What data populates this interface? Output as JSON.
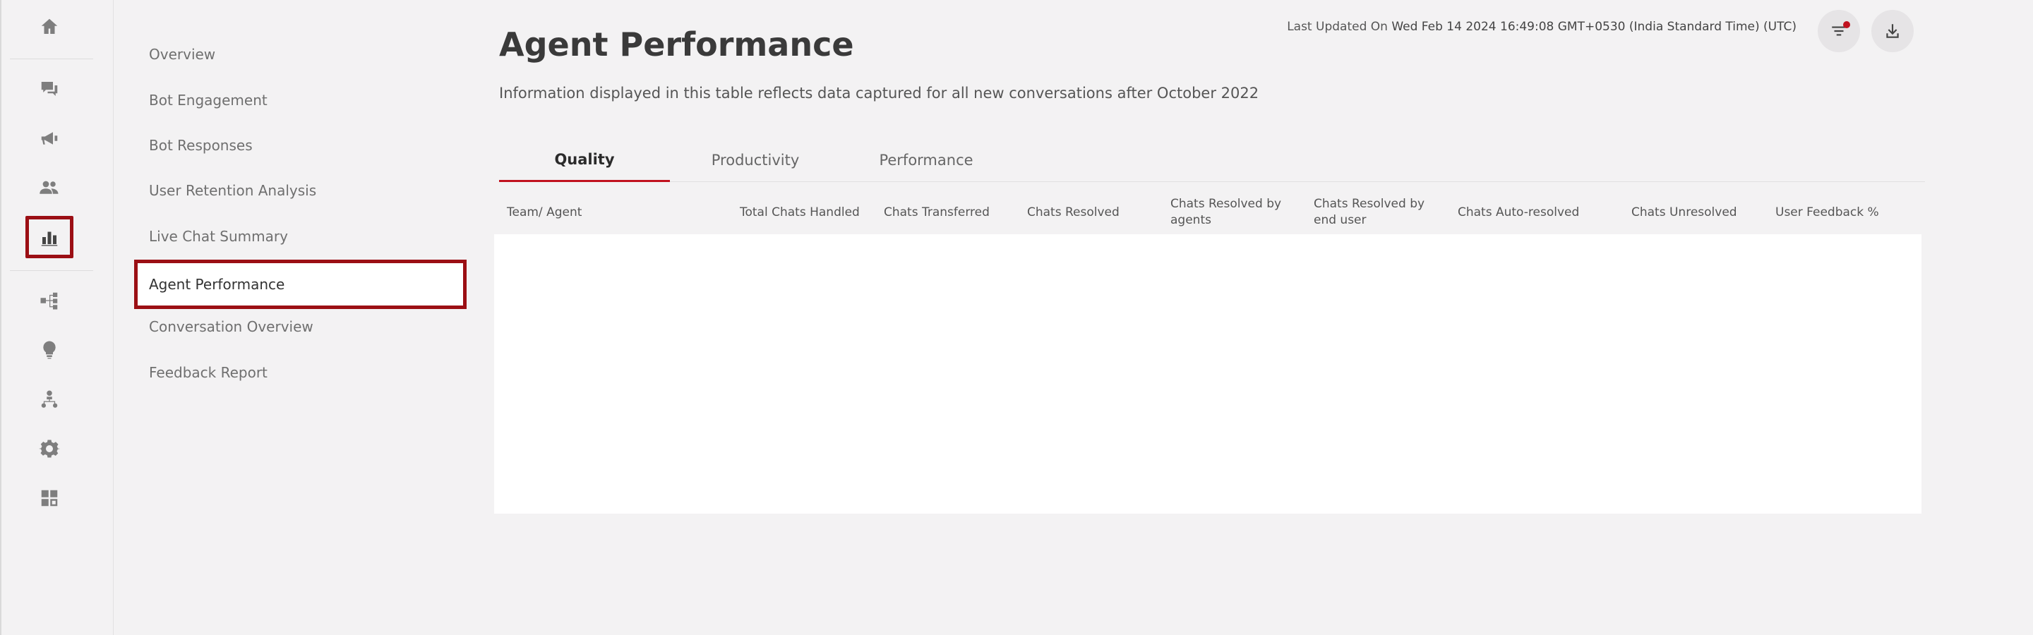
{
  "rail": {
    "icons": [
      "home-icon",
      "chat-icon",
      "megaphone-icon",
      "users-icon",
      "bar-chart-icon",
      "workflow-icon",
      "lightbulb-icon",
      "org-chart-icon",
      "gear-icon",
      "integrations-icon"
    ],
    "active": "bar-chart-icon"
  },
  "subnav": {
    "items": [
      {
        "label": "Overview"
      },
      {
        "label": "Bot Engagement"
      },
      {
        "label": "Bot Responses"
      },
      {
        "label": "User Retention Analysis"
      },
      {
        "label": "Live Chat Summary"
      },
      {
        "label": "Agent Performance"
      },
      {
        "label": "Conversation Overview"
      },
      {
        "label": "Feedback Report"
      }
    ],
    "active_label": "Agent Performance"
  },
  "header": {
    "title": "Agent Performance",
    "subtitle": "Information displayed in this table reflects data captured for all new conversations after October 2022",
    "last_updated_label": "Last Updated On",
    "last_updated_value": "Wed Feb 14 2024 16:49:08 GMT+0530 (India Standard Time) (UTC)"
  },
  "tabs": [
    {
      "label": "Quality",
      "active": true
    },
    {
      "label": "Productivity",
      "active": false
    },
    {
      "label": "Performance",
      "active": false
    }
  ],
  "table": {
    "columns": [
      "Team/ Agent",
      "Total Chats Handled",
      "Chats Transferred",
      "Chats Resolved",
      "Chats Resolved by agents",
      "Chats Resolved by end user",
      "Chats Auto-resolved",
      "Chats Unresolved",
      "User Feedback %"
    ],
    "rows": []
  },
  "colors": {
    "accent": "#c1121f",
    "highlight_border": "#9b0f14",
    "background": "#f3f2f3"
  }
}
